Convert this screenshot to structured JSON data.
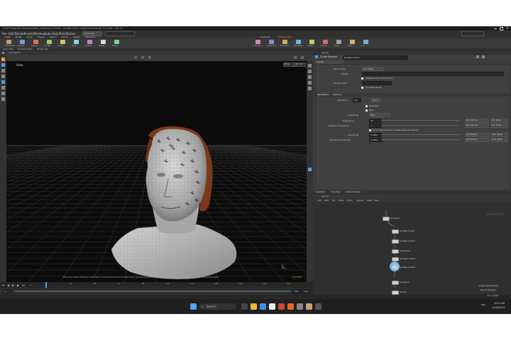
{
  "window": {
    "title": "E:/3D Projects/9_Hockey/Groom_sir/Jhonny_03.hiplc - Houdini Indie Limited-Commercial 21.0.440 - Py3.11"
  },
  "menu": [
    "File",
    "Edit",
    "Render",
    "Assets",
    "Windows",
    "Labs",
    "Help",
    "MultiMaster"
  ],
  "desktop_selector": "Technical",
  "shelf_tabs": [
    "Create",
    "Modify",
    "Model",
    "Polygon",
    "Deform",
    "Texture",
    "Rigging",
    "Characters",
    "Constraints",
    "Guide Process"
  ],
  "shelf_tools": [
    "Add Guides",
    "Groom",
    "Curves",
    "Sculpt",
    "Draw",
    "Plant",
    "Groom",
    "Planes",
    "Blend",
    "Hair Gen",
    "Guide Sim",
    "Constrain",
    "Simulate",
    "Deform",
    "Clump",
    "Frizz",
    "Bend",
    "Curl"
  ],
  "panel_tabs": [
    "Scene View",
    "Animation Editor",
    "Render View"
  ],
  "viewport": {
    "path": "obj / groom",
    "label": "View",
    "persp_menu": "Persp",
    "camera_menu": "No cam",
    "status_text": "Left mouse tumbles. Middle pans. Right dollies. Ctrl+Alt+Left box-zooms. Ctrl+Right zooms. Spacebar-Ctrl-Left tilts. Hold L for alternate tumble, dolly, and zoom.  M or Alt+M for First Person Navigation.",
    "indie_badge": "Indie Edition"
  },
  "params": {
    "path": "groom",
    "node_type": "Guide Process",
    "node_name": "guideprocess2",
    "tab": "Guides",
    "group_type": "Primitives",
    "rows": [
      {
        "label": "Group Type",
        "value": "Primitives"
      },
      {
        "label": "Group",
        "value": ""
      },
      {
        "label": "Enable Pins for Root Point",
        "value": ""
      },
      {
        "label": "Process Skin",
        "value": "Enable Pins"
      },
      {
        "label": "",
        "value": "Simulate Roots"
      }
    ],
    "subtabs": [
      "Operations",
      "Masking"
    ],
    "operation_label": "Operation",
    "operation_value": "Set",
    "operation_btn": "Clear",
    "checks": [
      "Visualize",
      "Bias"
    ],
    "amplitude_label": "Amplitude",
    "amplitude_value": "Bias",
    "frequency_label": "Frequency",
    "frequency_value": "10",
    "freq_override": "No Override",
    "freq_attr": "Frq. Ramp",
    "rel_freq_label": "Relative Frequency",
    "rel_freq_value": "1",
    "rel_override": "No Override",
    "rel_attr": "Frq. Ramp",
    "limit_label": "Limit Frequency To Guides Segment Values",
    "amplitude2_label": "Amplitude",
    "amplitude2_value": "0.0081",
    "amp_override": "No Override",
    "amp_attr": "Amp. Ramp",
    "rand_label": "Random Amplitude",
    "rand_value": "0.0081",
    "rand_override": "No Override",
    "rand_attr": "Amp. Ramp"
  },
  "network": {
    "tabs": [
      "Geometry",
      "Tree View",
      "Material Palette"
    ],
    "path": "groom",
    "menu": [
      "Add",
      "Edit",
      "Go",
      "View",
      "Tools",
      "Layout",
      "Labs",
      "Help"
    ],
    "context_label": "Geometry",
    "nodes": [
      "hairgen1",
      "guideprocess1",
      "guideprocess3",
      "guidesim1",
      "guideprocess4",
      "guideprocess2",
      "hairgen2",
      "Output"
    ]
  },
  "timeline": {
    "frame": "1",
    "start": "1",
    "end": "240",
    "end2": "240",
    "ticks": [
      "1",
      "24",
      "48",
      "72",
      "96",
      "120",
      "144",
      "168",
      "192",
      "216",
      "240"
    ]
  },
  "bottom": {
    "keys_label": "0 keys, 0/0 channels",
    "key_all": "Key All Channels",
    "auto_update": "Auto Update"
  },
  "taskbar": {
    "search_placeholder": "Search",
    "time": "10:01 AM",
    "date": "12/26/2024",
    "lang": "ENG"
  },
  "colors": {
    "accent": "#e8a23a",
    "viewport_bg": "#0b0b0b",
    "grid": "#3a3a3a",
    "selection_blue": "#5aa0d8"
  }
}
